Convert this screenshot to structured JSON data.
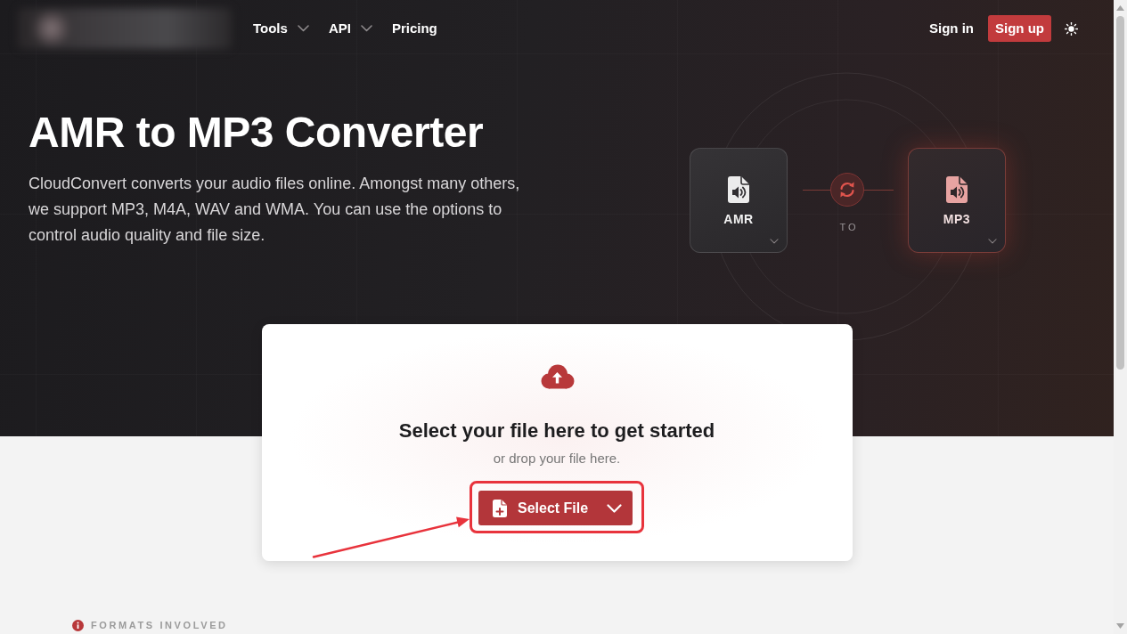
{
  "navbar": {
    "menu": [
      {
        "label": "Tools",
        "dropdown": true
      },
      {
        "label": "API",
        "dropdown": true
      },
      {
        "label": "Pricing",
        "dropdown": false
      }
    ],
    "sign_in": "Sign in",
    "sign_up": "Sign up"
  },
  "hero": {
    "title": "AMR to MP3 Converter",
    "description": "CloudConvert converts your audio files online. Amongst many others, we support MP3, M4A, WAV and WMA. You can use the options to control audio quality and file size."
  },
  "conversion": {
    "formats": [
      {
        "kind": "source",
        "label": "AMR"
      },
      {
        "kind": "target",
        "label": "MP3"
      }
    ],
    "connector": "TO"
  },
  "upload": {
    "title": "Select your file here to get started",
    "subtitle": "or drop your file here.",
    "button": {
      "label": "Select File",
      "highlighted": true
    }
  },
  "formats_section": {
    "heading": "FORMATS INVOLVED"
  }
}
